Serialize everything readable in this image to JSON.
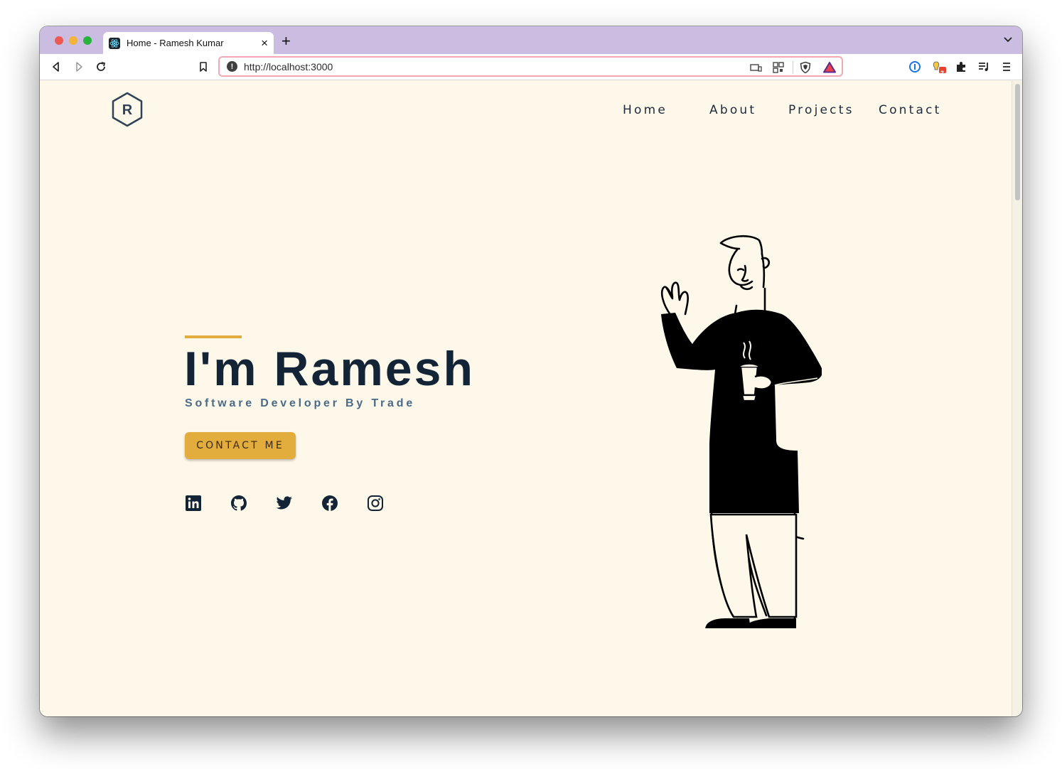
{
  "browser": {
    "tab_title": "Home - Ramesh Kumar",
    "new_tab_label": "+",
    "tab_close_label": "×",
    "url": "http://localhost:3000",
    "url_info_label": "!",
    "extension_badge_count": "3"
  },
  "site": {
    "logo_letter": "R",
    "nav": [
      "Home",
      "About",
      "Projects",
      "Contact"
    ],
    "hero": {
      "title": "I'm Ramesh",
      "subtitle": "Software Developer By Trade",
      "cta_label": "CONTACT ME"
    },
    "socials": [
      "linkedin-icon",
      "github-icon",
      "twitter-icon",
      "facebook-icon",
      "instagram-icon"
    ],
    "colors": {
      "background": "#fdf8ea",
      "accent": "#e2ad3c",
      "heading": "#142437",
      "subtitle": "#4a6a88",
      "tab_strip": "#cbbde2"
    }
  }
}
